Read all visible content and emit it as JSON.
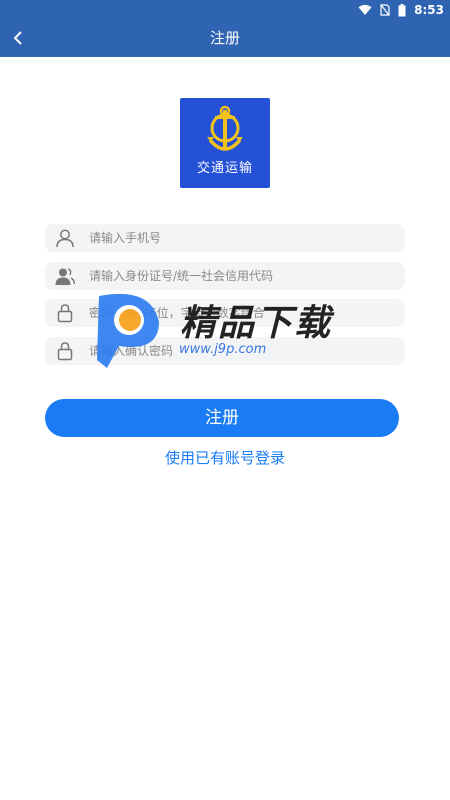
{
  "status_bar": {
    "time": "8:53"
  },
  "header": {
    "title": "注册"
  },
  "logo": {
    "text": "交通运输"
  },
  "form": {
    "phone_placeholder": "请输入手机号",
    "id_placeholder": "请输入身份证号/统一社会信用代码",
    "password_placeholder": "密码，最少6位，字母、数字组合",
    "confirm_placeholder": "请输入确认密码"
  },
  "actions": {
    "register_label": "注册",
    "login_link": "使用已有账号登录"
  },
  "watermark": {
    "title": "精品下载",
    "url": "www.j9p.com"
  },
  "colors": {
    "header_bg": "#2f64b3",
    "accent": "#1a7cf5",
    "field_bg": "#f3f4f6",
    "logo_bg": "#2451d6"
  }
}
